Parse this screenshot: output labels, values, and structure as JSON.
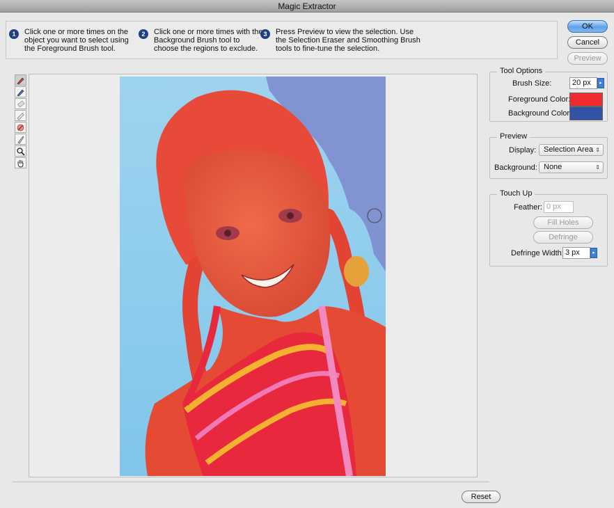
{
  "window": {
    "title": "Magic Extractor"
  },
  "instructions": [
    {
      "num": "1",
      "text": "Click one or more times on the object you want to select using the Foreground Brush tool."
    },
    {
      "num": "2",
      "text": "Click one or more times with the Background Brush tool to choose the regions to exclude."
    },
    {
      "num": "3",
      "text": "Press Preview to view the selection. Use the Selection Eraser and Smoothing Brush tools to fine-tune the selection."
    }
  ],
  "buttons": {
    "ok": "OK",
    "cancel": "Cancel",
    "preview": "Preview",
    "reset": "Reset"
  },
  "tools": [
    "foreground-brush-icon",
    "background-brush-icon",
    "point-eraser-icon",
    "add-to-selection-icon",
    "remove-from-selection-icon",
    "smoothing-brush-icon",
    "zoom-icon",
    "hand-icon"
  ],
  "tool_options": {
    "title": "Tool Options",
    "brush_size_label": "Brush Size:",
    "brush_size_value": "20 px",
    "foreground_label": "Foreground Color:",
    "foreground_color": "#ee2b2e",
    "background_label": "Background Color:",
    "background_color": "#3352a3"
  },
  "preview": {
    "title": "Preview",
    "display_label": "Display:",
    "display_value": "Selection Area",
    "background_label": "Background:",
    "background_value": "None"
  },
  "touch_up": {
    "title": "Touch Up",
    "feather_label": "Feather:",
    "feather_value": "0 px",
    "fill_holes": "Fill Holes",
    "defringe": "Defringe",
    "defringe_width_label": "Defringe Width:",
    "defringe_width_value": "3 px"
  }
}
